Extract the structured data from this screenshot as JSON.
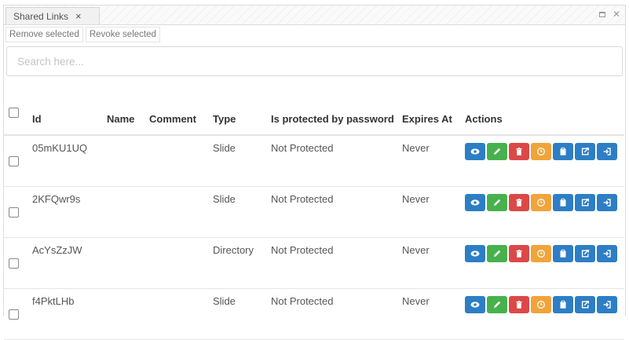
{
  "tab": {
    "label": "Shared Links",
    "close": "×"
  },
  "toolbar": {
    "remove_label": "Remove selected",
    "revoke_label": "Revoke selected"
  },
  "search": {
    "placeholder": "Search here..."
  },
  "table": {
    "headers": [
      "Id",
      "Name",
      "Comment",
      "Type",
      "Is protected by password",
      "Expires At",
      "Actions"
    ],
    "rows": [
      {
        "id": "05mKU1UQ",
        "name": "",
        "comment": "",
        "type": "Slide",
        "protected": "Not Protected",
        "expires": "Never"
      },
      {
        "id": "2KFQwr9s",
        "name": "",
        "comment": "",
        "type": "Slide",
        "protected": "Not Protected",
        "expires": "Never"
      },
      {
        "id": "AcYsZzJW",
        "name": "",
        "comment": "",
        "type": "Directory",
        "protected": "Not Protected",
        "expires": "Never"
      },
      {
        "id": "f4PktLHb",
        "name": "",
        "comment": "",
        "type": "Slide",
        "protected": "Not Protected",
        "expires": "Never"
      }
    ]
  },
  "action_icons": [
    "eye-icon",
    "pencil-icon",
    "trash-icon",
    "clock-icon",
    "clipboard-icon",
    "share-icon",
    "sign-in-icon"
  ],
  "colors": {
    "blue": "#2d7ec5",
    "green": "#47b24d",
    "red": "#dc4848",
    "orange": "#f0a43a"
  }
}
